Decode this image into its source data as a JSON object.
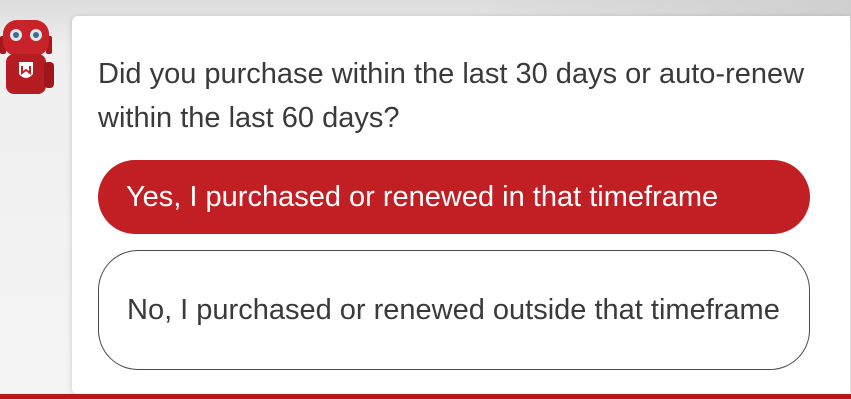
{
  "chat": {
    "question": "Did you purchase within the last 30 days or auto-renew within the last 60 days?",
    "options": [
      {
        "label": "Yes, I purchased or renewed in that timeframe"
      },
      {
        "label": "No, I purchased or renewed outside that timeframe"
      }
    ]
  },
  "colors": {
    "accent": "#c21f25",
    "text": "#3a3a3a",
    "card": "#ffffff"
  },
  "icons": {
    "avatar": "robot-assistant-icon"
  }
}
